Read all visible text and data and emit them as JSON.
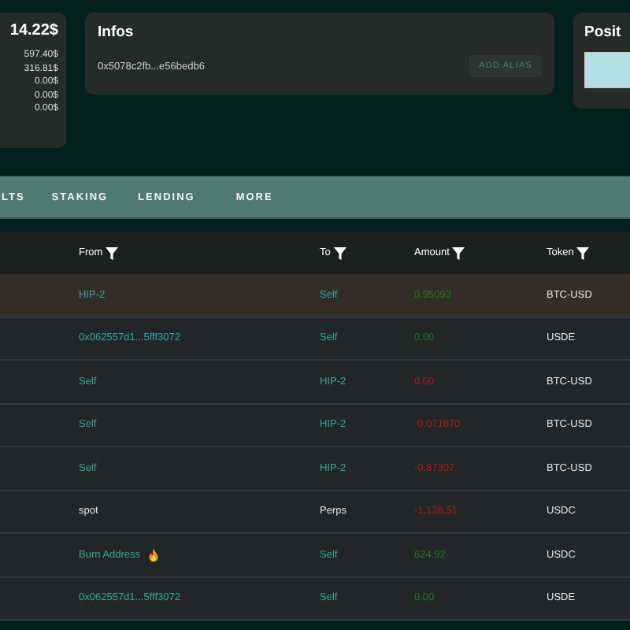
{
  "balance_card": {
    "total": "14.22$",
    "breakdown": [
      "597.40$",
      "316.81$",
      "0.00$",
      "0.00$",
      "0.00$"
    ]
  },
  "infos_card": {
    "title": "Infos",
    "address": "0x5078c2fb...e56bedb6",
    "button": "ADD ALIAS"
  },
  "positions_card": {
    "title": "Posit"
  },
  "tabs": [
    {
      "label": "LTS",
      "selected": false
    },
    {
      "label": "STAKING",
      "selected": false
    },
    {
      "label": "LENDING",
      "selected": false
    },
    {
      "label": "MORE",
      "selected": false
    }
  ],
  "table": {
    "columns": [
      "From",
      "To",
      "Amount",
      "Token"
    ],
    "rows": [
      {
        "from": "HIP-2",
        "from_link": true,
        "to": "Self",
        "to_link": true,
        "amount": "0.95093",
        "negative": false,
        "token": "BTC-USD",
        "burn": false,
        "selected": true
      },
      {
        "from": "0x062557d1...5fff3072",
        "from_link": true,
        "to": "Self",
        "to_link": true,
        "amount": "0.00",
        "negative": false,
        "token": "USDE",
        "burn": false,
        "selected": false
      },
      {
        "from": "Self",
        "from_link": true,
        "to": "HIP-2",
        "to_link": true,
        "amount": "0.00",
        "negative": true,
        "token": "BTC-USD",
        "burn": false,
        "selected": false
      },
      {
        "from": "Self",
        "from_link": true,
        "to": "HIP-2",
        "to_link": true,
        "amount": "-0.071670",
        "negative": true,
        "token": "BTC-USD",
        "burn": false,
        "selected": false
      },
      {
        "from": "Self",
        "from_link": true,
        "to": "HIP-2",
        "to_link": true,
        "amount": "-0.87307",
        "negative": true,
        "token": "BTC-USD",
        "burn": false,
        "selected": false
      },
      {
        "from": "spot",
        "from_link": false,
        "to": "Perps",
        "to_link": false,
        "amount": "-1,128.51",
        "negative": true,
        "token": "USDC",
        "burn": false,
        "selected": false
      },
      {
        "from": "Burn Address",
        "from_link": true,
        "to": "Self",
        "to_link": true,
        "amount": "624.92",
        "negative": false,
        "token": "USDC",
        "burn": true,
        "selected": false
      },
      {
        "from": "0x062557d1...5fff3072",
        "from_link": true,
        "to": "Self",
        "to_link": true,
        "amount": "0.00",
        "negative": false,
        "token": "USDE",
        "burn": false,
        "selected": false
      }
    ]
  }
}
